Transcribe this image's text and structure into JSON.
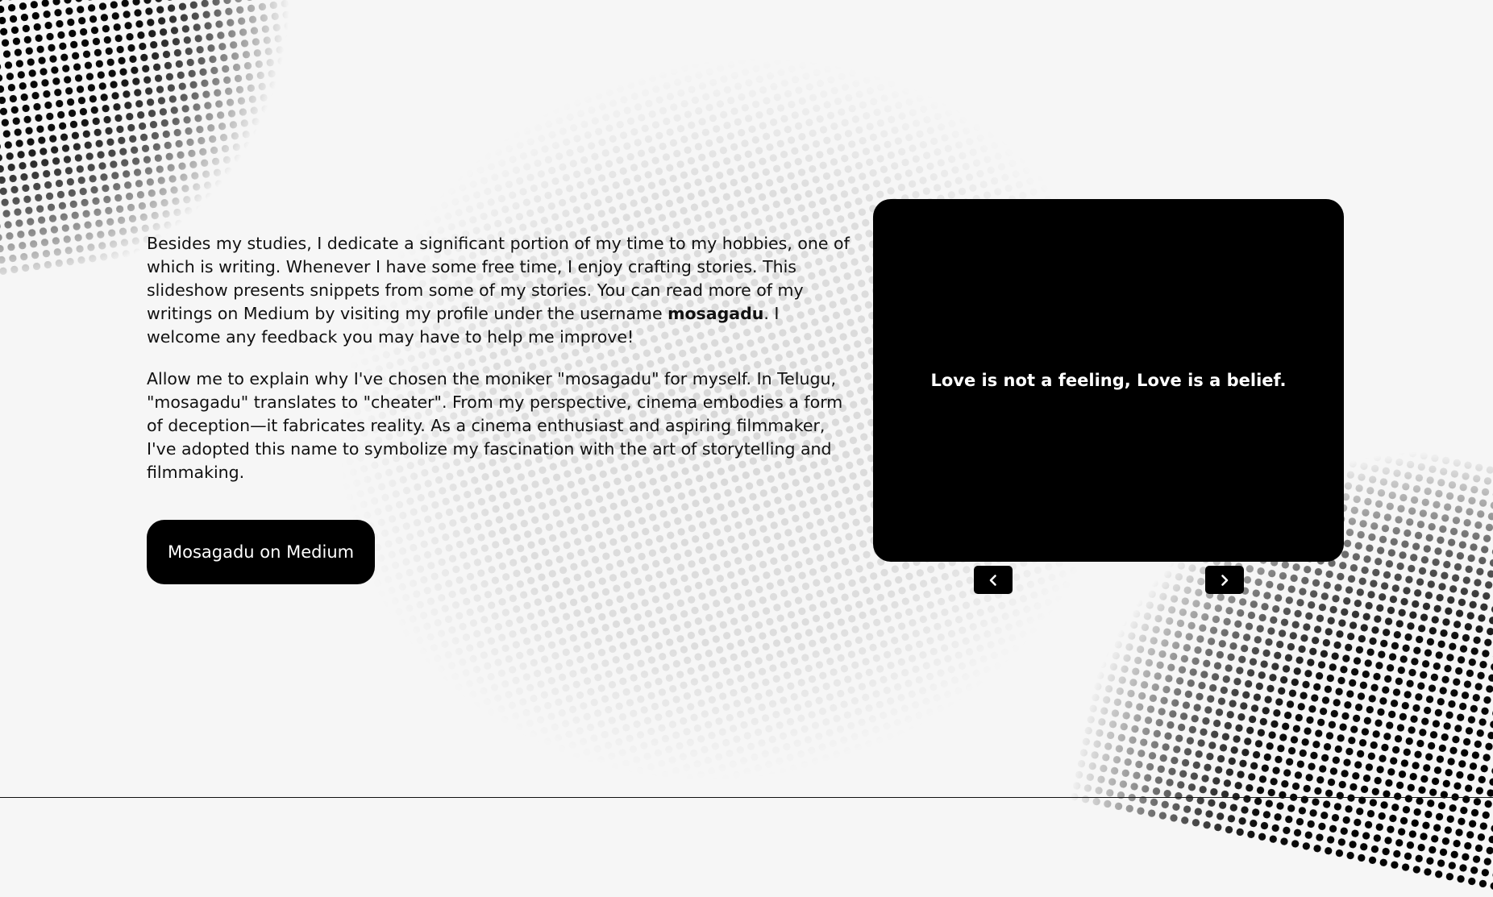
{
  "intro": {
    "para1_before": "Besides my studies, I dedicate a significant portion of my time to my hobbies, one of which is writing. Whenever I have some free time, I enjoy crafting stories. This slideshow presents snippets from some of my stories. You can read more of my writings on Medium by visiting my profile under the username ",
    "username": "mosagadu",
    "para1_after": ". I welcome any feedback you may have to help me improve!",
    "para2": "Allow me to explain why I've chosen the moniker \"mosagadu\" for myself. In Telugu, \"mosagadu\" translates to \"cheater\". From my perspective, cinema embodies a form of deception—it fabricates reality. As a cinema enthusiast and aspiring filmmaker, I've adopted this name to symbolize my fascination with the art of storytelling and filmmaking."
  },
  "button": {
    "label": "Mosagadu on Medium"
  },
  "slideshow": {
    "current_text": "Love is not a feeling, Love is a belief.",
    "prev_icon": "chevron-left-icon",
    "next_icon": "chevron-right-icon"
  },
  "colors": {
    "background": "#f6f6f6",
    "accent": "#000000",
    "text": "#111111",
    "button_text": "#ffffff"
  }
}
